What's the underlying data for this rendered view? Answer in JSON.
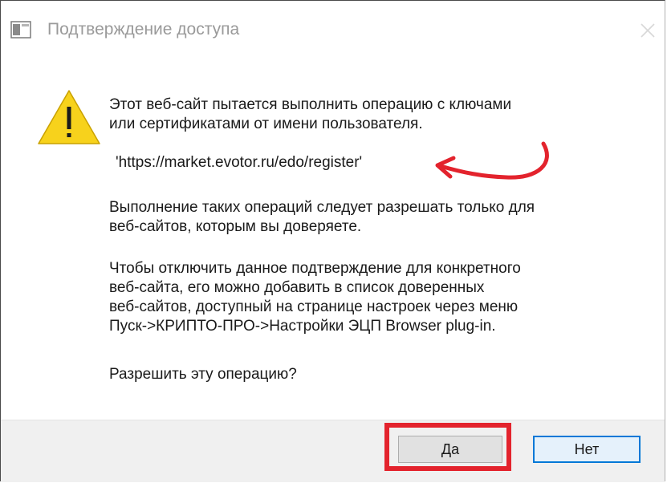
{
  "window": {
    "title": "Подтверждение доступа",
    "icons": {
      "app": "window-app-icon",
      "close": "close-icon",
      "warning": "warning-icon",
      "annotation": "red-arrow-annotation"
    }
  },
  "message": {
    "line1": "Этот веб-сайт пытается выполнить операцию с ключами\nили сертификатами от имени пользователя.",
    "url": "'https://market.evotor.ru/edo/register'",
    "line2": "Выполнение таких операций следует разрешать только для\nвеб-сайтов, которым вы доверяете.",
    "line3": "Чтобы отключить данное подтверждение для конкретного\nвеб-сайта, его можно добавить в список доверенных\nвеб-сайтов, доступный на странице настроек через меню\nПуск->КРИПТО-ПРО->Настройки ЭЦП Browser plug-in.",
    "question": "Разрешить эту операцию?"
  },
  "buttons": {
    "yes": "Да",
    "no": "Нет"
  },
  "colors": {
    "annotation_red": "#e3232d",
    "warning_yellow": "#f7d21c",
    "focus_blue": "#0078d7"
  }
}
